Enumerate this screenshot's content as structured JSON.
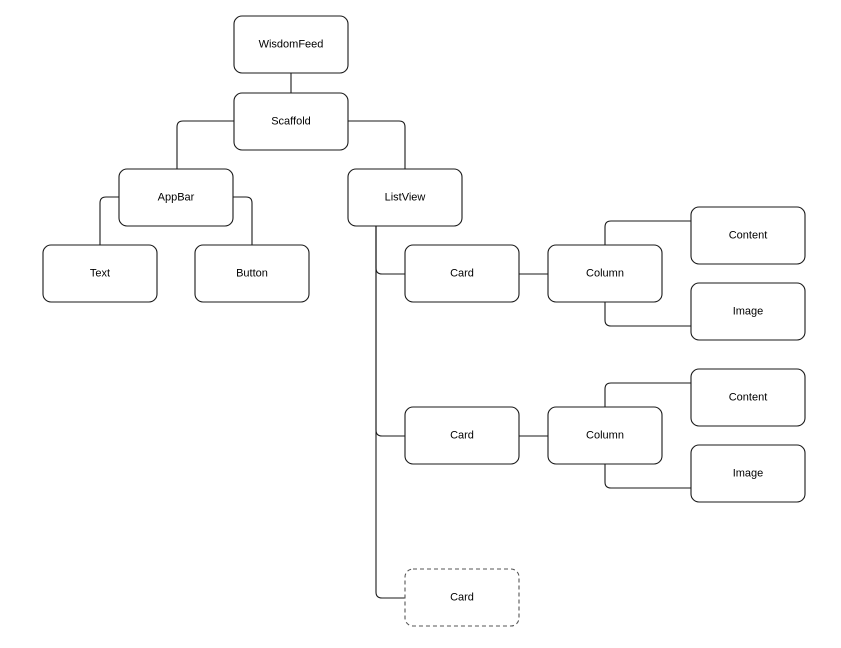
{
  "diagram": {
    "nodes": [
      {
        "id": "wisdomfeed",
        "label": "WisdomFeed"
      },
      {
        "id": "scaffold",
        "label": "Scaffold"
      },
      {
        "id": "appbar",
        "label": "AppBar"
      },
      {
        "id": "listview",
        "label": "ListView"
      },
      {
        "id": "text",
        "label": "Text"
      },
      {
        "id": "button",
        "label": "Button"
      },
      {
        "id": "card1",
        "label": "Card"
      },
      {
        "id": "column1",
        "label": "Column"
      },
      {
        "id": "content1",
        "label": "Content"
      },
      {
        "id": "image1",
        "label": "Image"
      },
      {
        "id": "card2",
        "label": "Card"
      },
      {
        "id": "column2",
        "label": "Column"
      },
      {
        "id": "content2",
        "label": "Content"
      },
      {
        "id": "image2",
        "label": "Image"
      },
      {
        "id": "card3",
        "label": "Card",
        "style": "dashed"
      }
    ],
    "edges": [
      [
        "wisdomfeed",
        "scaffold"
      ],
      [
        "scaffold",
        "appbar"
      ],
      [
        "scaffold",
        "listview"
      ],
      [
        "appbar",
        "text"
      ],
      [
        "appbar",
        "button"
      ],
      [
        "listview",
        "card1"
      ],
      [
        "listview",
        "card2"
      ],
      [
        "listview",
        "card3"
      ],
      [
        "card1",
        "column1"
      ],
      [
        "column1",
        "content1"
      ],
      [
        "column1",
        "image1"
      ],
      [
        "card2",
        "column2"
      ],
      [
        "column2",
        "content2"
      ],
      [
        "column2",
        "image2"
      ]
    ]
  }
}
